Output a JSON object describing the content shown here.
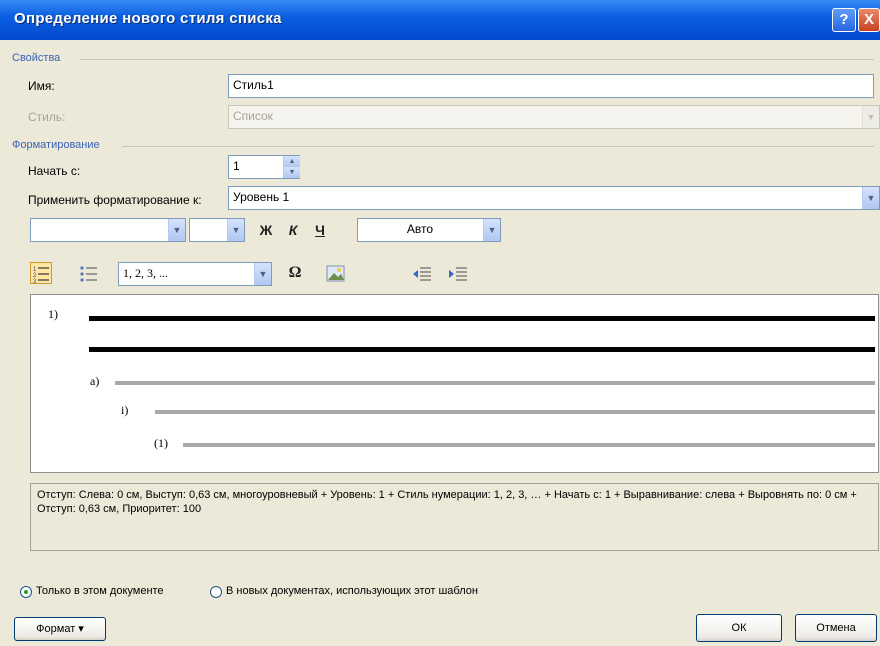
{
  "dialog": {
    "title": "Определение нового стиля списка",
    "help_glyph": "?",
    "close_glyph": "X"
  },
  "properties": {
    "section_label": "Свойства",
    "name_label": "Имя:",
    "name_value": "Стиль1",
    "style_label": "Стиль:",
    "style_value": "Список"
  },
  "formatting": {
    "section_label": "Форматирование",
    "start_label": "Начать с:",
    "start_value": "1",
    "apply_label": "Применить форматирование к:",
    "apply_value": "Уровень 1",
    "font_name_value": "",
    "font_size_value": "",
    "bold_glyph": "Ж",
    "italic_glyph": "К",
    "underline_glyph": "Ч",
    "color_value": "Авто",
    "numbering_format_value": "1, 2, 3, ...",
    "symbol_glyph": "Ω"
  },
  "preview": {
    "level1_label": "1)",
    "level2_label": "a)",
    "level3_label": "i)",
    "level4_label": "(1)"
  },
  "description": "Отступ: Слева: 0 см, Выступ: 0,63 см, многоуровневый + Уровень: 1 + Стиль нумерации: 1, 2, 3, … + Начать с: 1 + Выравнивание: слева + Выровнять по: 0 см + Отступ: 0,63 см, Приоритет: 100",
  "scope": {
    "only_document_label": "Только в этом документе",
    "new_documents_label": "В новых документах, использующих этот шаблон",
    "selected": "only_document"
  },
  "buttons": {
    "format_label": "Формат",
    "format_arrow": "▾",
    "ok_label": "ОК",
    "cancel_label": "Отмена"
  },
  "colors": {
    "title_bar": "#0a5fe0",
    "dialog_bg": "#ece9d8",
    "section_title": "#3a64b5"
  }
}
